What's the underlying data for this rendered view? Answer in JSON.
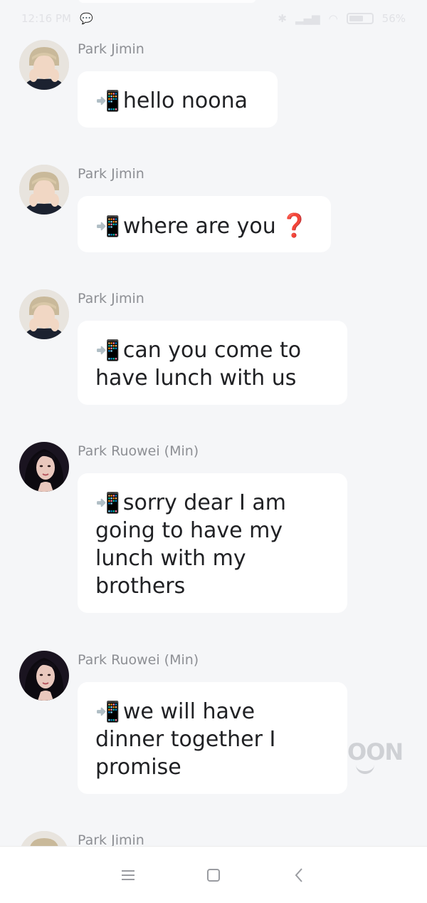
{
  "status_bar": {
    "time": "12:16 PM",
    "battery": "56%"
  },
  "messages": [
    {
      "sender": "Park Jimin",
      "avatar": "jimin",
      "prefix_icon": "📲",
      "text": "hello noona",
      "suffix": ""
    },
    {
      "sender": "Park Jimin",
      "avatar": "jimin",
      "prefix_icon": "📲",
      "text": "where are you",
      "suffix": "❓"
    },
    {
      "sender": "Park Jimin",
      "avatar": "jimin",
      "prefix_icon": "📲",
      "text": "can you come to have lunch with us",
      "suffix": ""
    },
    {
      "sender": "Park Ruowei (Min)",
      "avatar": "ruowei",
      "prefix_icon": "📲",
      "text": "sorry dear I am going to have my lunch with my brothers",
      "suffix": ""
    },
    {
      "sender": "Park Ruowei (Min)",
      "avatar": "ruowei",
      "prefix_icon": "📲",
      "text": "we will have dinner together I promise",
      "suffix": ""
    },
    {
      "sender": "Park Jimin",
      "avatar": "jimin",
      "prefix_icon": "",
      "text": "",
      "suffix": ""
    }
  ],
  "watermark": "OON",
  "nav": {
    "menu_icon": "menu-icon",
    "home_icon": "home-square-icon",
    "back_icon": "back-chevron-icon"
  },
  "colors": {
    "background": "#f5f6f8",
    "bubble": "#ffffff",
    "sender_name": "#8d8f94",
    "question_mark": "#e0362d"
  }
}
